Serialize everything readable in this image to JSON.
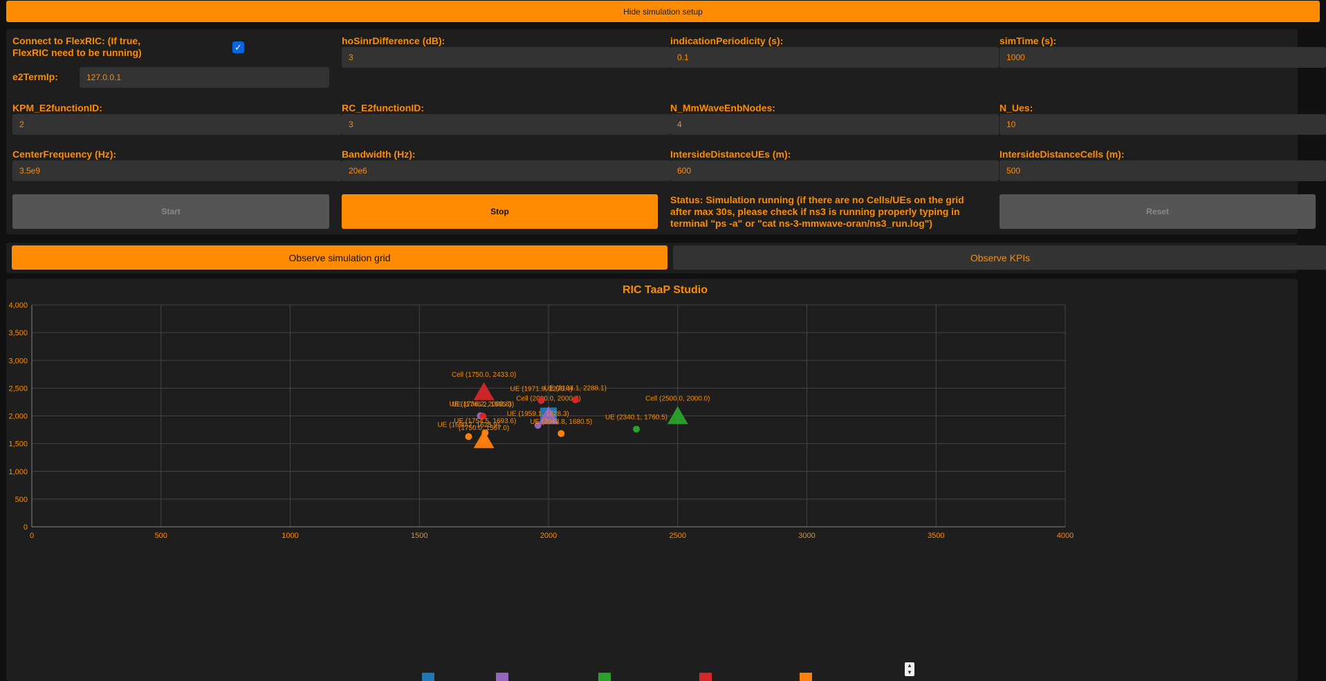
{
  "toggle_label": "Hide simulation setup",
  "fields": {
    "connect_label_line1": "Connect to FlexRIC: (If true,",
    "connect_label_line2": "FlexRIC need to be running)",
    "e2term_label": "e2TermIp:",
    "e2term_value": "127.0.0.1",
    "ho_label": "hoSinrDifference (dB):",
    "ho_value": "3",
    "ind_label": "indicationPeriodicity (s):",
    "ind_value": "0.1",
    "sim_label": "simTime (s):",
    "sim_value": "1000",
    "kpm_label": "KPM_E2functionID:",
    "kpm_value": "2",
    "rc_label": "RC_E2functionID:",
    "rc_value": "3",
    "nenb_label": "N_MmWaveEnbNodes:",
    "nenb_value": "4",
    "nues_label": "N_Ues:",
    "nues_value": "10",
    "cf_label": "CenterFrequency (Hz):",
    "cf_value": "3.5e9",
    "bw_label": "Bandwidth (Hz):",
    "bw_value": "20e6",
    "isdue_label": "IntersideDistanceUEs (m):",
    "isdue_value": "600",
    "isdcell_label": "IntersideDistanceCells (m):",
    "isdcell_value": "500"
  },
  "buttons": {
    "start": "Start",
    "stop": "Stop",
    "reset": "Reset"
  },
  "status_text": "Status: Simulation running (if there are no Cells/UEs on the grid after max 30s, please check if ns3 is running properly typing in terminal \"ps -a\" or \"cat ns-3-mmwave-oran/ns3_run.log\")",
  "tabs": {
    "grid": "Observe simulation grid",
    "kpis": "Observe KPIs"
  },
  "chart_data": {
    "type": "scatter",
    "title": "RIC TaaP Studio",
    "xlim": [
      0,
      4000
    ],
    "ylim": [
      0,
      4000
    ],
    "x_ticks": [
      "0",
      "500",
      "1000",
      "1500",
      "2000",
      "2500",
      "3000",
      "3500",
      "4000"
    ],
    "y_ticks": [
      "0",
      "500",
      "1,000",
      "1,500",
      "2,000",
      "2,500",
      "3,000",
      "3,500",
      "4,000"
    ],
    "grid": true,
    "points": [
      {
        "kind": "cell",
        "x": 2000.0,
        "y": 2000.0,
        "label": "Cell (2000.0, 2000.0)",
        "color": "#1f77b4",
        "marker": "square"
      },
      {
        "kind": "cell",
        "x": 2000.0,
        "y": 2000.0,
        "label": "",
        "color": "#9467bd",
        "marker": "triangle"
      },
      {
        "kind": "cell",
        "x": 1750.0,
        "y": 2433.0,
        "label": "Cell (1750.0, 2433.0)",
        "color": "#d62728",
        "marker": "triangle"
      },
      {
        "kind": "cell",
        "x": 2500.0,
        "y": 2000.0,
        "label": "Cell (2500.0, 2000.0)",
        "color": "#2ca02c",
        "marker": "triangle"
      },
      {
        "kind": "cell",
        "x": 1750.0,
        "y": 1567.0,
        "label": "",
        "color": "#ff7f0e",
        "marker": "triangle"
      },
      {
        "kind": "ue",
        "x": 1971.9,
        "y": 2276.4,
        "label": "UE (1971.9, 2276.4)",
        "color": "#d62728"
      },
      {
        "kind": "ue",
        "x": 2104.1,
        "y": 2288.1,
        "label": "UE (2104.1, 2288.1)",
        "color": "#d62728"
      },
      {
        "kind": "ue",
        "x": 1736.2,
        "y": 2000.8,
        "label": "UE (1736.2, 2000.8)",
        "color": "#9467bd"
      },
      {
        "kind": "ue",
        "x": 1746.2,
        "y": 1995.3,
        "label": "UE (1746.2, 1995.3)",
        "color": "#d62728"
      },
      {
        "kind": "ue",
        "x": 1959.1,
        "y": 1828.3,
        "label": "UE (1959.1, 1828.3)",
        "color": "#9467bd"
      },
      {
        "kind": "ue",
        "x": 1754.5,
        "y": 1693.6,
        "label": "UE (1754.5, 1693.6)",
        "color": "#ff7f0e"
      },
      {
        "kind": "ue",
        "x": 1690.7,
        "y": 1625.9,
        "label": "UE (1690.7, 1625.9)",
        "color": "#ff7f0e"
      },
      {
        "kind": "ue",
        "x": 2048.8,
        "y": 1680.5,
        "label": "UE (2048.8, 1680.5)",
        "color": "#ff7f0e"
      },
      {
        "kind": "ue",
        "x": 2340.1,
        "y": 1760.5,
        "label": "UE (2340.1, 1760.5)",
        "color": "#2ca02c"
      },
      {
        "kind": "ue",
        "x": 1750.0,
        "y": 1567.0,
        "label": "(1750.0, 1567.0)",
        "color": "#ff7f0e"
      }
    ],
    "legend_colors": [
      "#1f77b4",
      "#9467bd",
      "#2ca02c",
      "#d62728",
      "#ff7f0e"
    ]
  }
}
